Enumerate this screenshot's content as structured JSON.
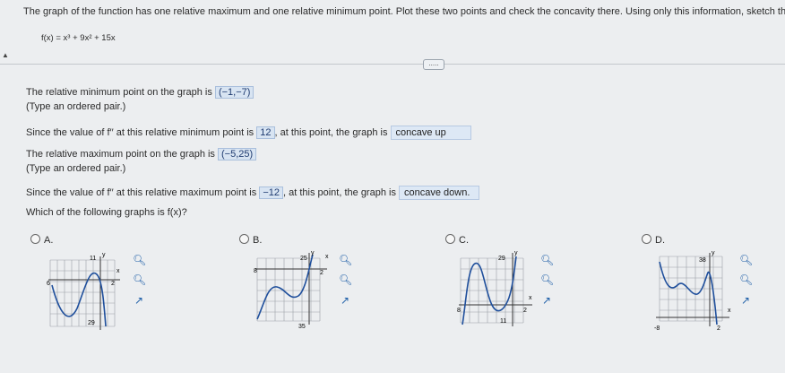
{
  "question": {
    "prompt": "The graph of the function has one relative maximum and one relative minimum point. Plot these two points and check the concavity there. Using only this information, sketch the graph.",
    "function": "f(x) = x³ + 9x² + 15x",
    "more_button": "....."
  },
  "relative_min": {
    "label": "The relative minimum point on the graph is",
    "value": "(−1,−7)",
    "hint": "(Type an ordered pair.)"
  },
  "min_concavity": {
    "before": "Since the value of f′′ at this relative minimum point is",
    "value": "12",
    "middle": ", at this point, the graph is",
    "answer": "concave up"
  },
  "relative_max": {
    "label": "The relative maximum point on the graph is",
    "value": "(−5,25)",
    "hint": "(Type an ordered pair.)"
  },
  "max_concavity": {
    "before": "Since the value of f′′ at this relative maximum point is",
    "value": "−12",
    "middle": ", at this point, the graph is",
    "answer": "concave down."
  },
  "which_graph": "Which of the following graphs is f(x)?",
  "options": [
    {
      "letter": "A.",
      "labels": {
        "top": "11",
        "left": "6",
        "right": "2",
        "bottom": "29",
        "x": "x",
        "y": "y"
      }
    },
    {
      "letter": "B.",
      "labels": {
        "top": "25",
        "left": "8",
        "right": "2",
        "bottom": "35",
        "x": "x",
        "y": "y"
      }
    },
    {
      "letter": "C.",
      "labels": {
        "top": "29",
        "left": "8",
        "right": "2",
        "bottom": "11",
        "x": "x",
        "y": "y"
      }
    },
    {
      "letter": "D.",
      "labels": {
        "top": "38",
        "left": "-8",
        "right": "2",
        "x": "x",
        "y": "y"
      }
    }
  ],
  "icons": [
    "zoom-in-icon",
    "zoom-out-icon",
    "expand-icon"
  ]
}
